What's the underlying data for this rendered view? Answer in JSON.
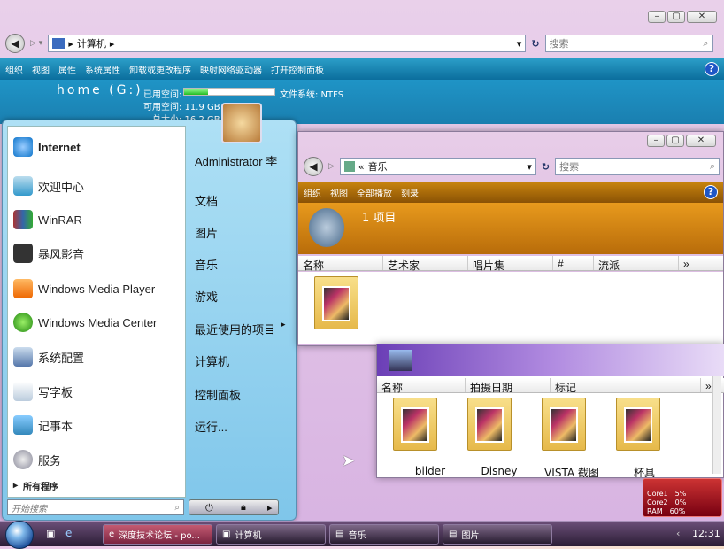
{
  "computer_window": {
    "address": "计算机",
    "search_placeholder": "搜索",
    "commands": [
      "组织",
      "视图",
      "属性",
      "系统属性",
      "卸载或更改程序",
      "映射网络驱动器",
      "打开控制面板"
    ],
    "drive_name": "home (G:)",
    "used_label": "已用空间:",
    "free_label": "可用空间: 11.9 GB",
    "total_label": "总大小: 16.2 GB",
    "fs_label": "文件系统: NTFS",
    "usage_fraction": 0.26
  },
  "start_menu": {
    "left_items": [
      "Internet",
      "欢迎中心",
      "WinRAR",
      "暴风影音",
      "Windows Media Player",
      "Windows Media Center",
      "系统配置",
      "写字板",
      "记事本",
      "服务"
    ],
    "all_programs": "所有程序",
    "search_placeholder": "开始搜索",
    "right_items": [
      "Administrator 李",
      "文档",
      "图片",
      "音乐",
      "游戏",
      "最近使用的项目",
      "计算机",
      "控制面板",
      "运行..."
    ]
  },
  "music_window": {
    "address": "音乐",
    "search_placeholder": "搜索",
    "commands": [
      "组织",
      "视图",
      "全部播放",
      "刻录"
    ],
    "count": "1 项目",
    "columns": [
      "名称",
      "艺术家",
      "唱片集",
      "#",
      "流派"
    ]
  },
  "pics_window": {
    "columns": [
      "名称",
      "拍摄日期",
      "标记"
    ],
    "folders": [
      "bilder",
      "Disney",
      "VISTA 截图",
      "杯具"
    ]
  },
  "gadget": {
    "core1": "Core1",
    "core1_v": "5%",
    "core2": "Core2",
    "core2_v": "0%",
    "ram": "RAM",
    "ram_v": "60%"
  },
  "taskbar": {
    "buttons": [
      "深度技术论坛 - po...",
      "计算机",
      "音乐",
      "图片"
    ],
    "clock": "12:31"
  }
}
